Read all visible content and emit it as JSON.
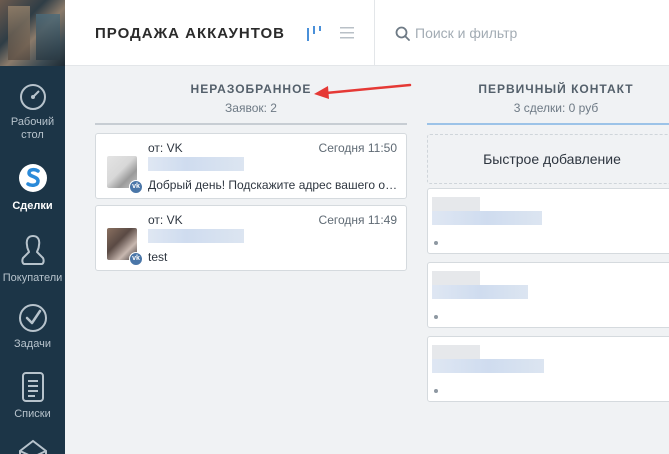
{
  "header": {
    "title": "ПРОДАЖА АККАУНТОВ",
    "search_placeholder": "Поиск и фильтр"
  },
  "sidebar": {
    "items": [
      {
        "label": "Рабочий стол",
        "icon": "dashboard-icon",
        "active": false
      },
      {
        "label": "Сделки",
        "icon": "deals-icon",
        "active": true
      },
      {
        "label": "Покупатели",
        "icon": "customers-icon",
        "active": false
      },
      {
        "label": "Задачи",
        "icon": "tasks-icon",
        "active": false
      },
      {
        "label": "Списки",
        "icon": "lists-icon",
        "active": false
      },
      {
        "label": "",
        "icon": "mail-icon",
        "active": false
      }
    ]
  },
  "columns": [
    {
      "title": "НЕРАЗОБРАННОЕ",
      "subtitle": "Заявок: 2"
    },
    {
      "title": "ПЕРВИЧНЫЙ КОНТАКТ",
      "subtitle": "3 сделки: 0 руб",
      "quick_add": "Быстрое добавление"
    }
  ],
  "leads": [
    {
      "source": "от: VK",
      "time": "Сегодня 11:50",
      "message": "Добрый день! Подскажите адрес вашего офиса",
      "badge": "vk"
    },
    {
      "source": "от: VK",
      "time": "Сегодня 11:49",
      "message": "test",
      "badge": "vk"
    }
  ],
  "colors": {
    "sidebar": "#1c3547",
    "accent": "#4a90d9",
    "arrow": "#e53935",
    "vk": "#4a76a8"
  }
}
